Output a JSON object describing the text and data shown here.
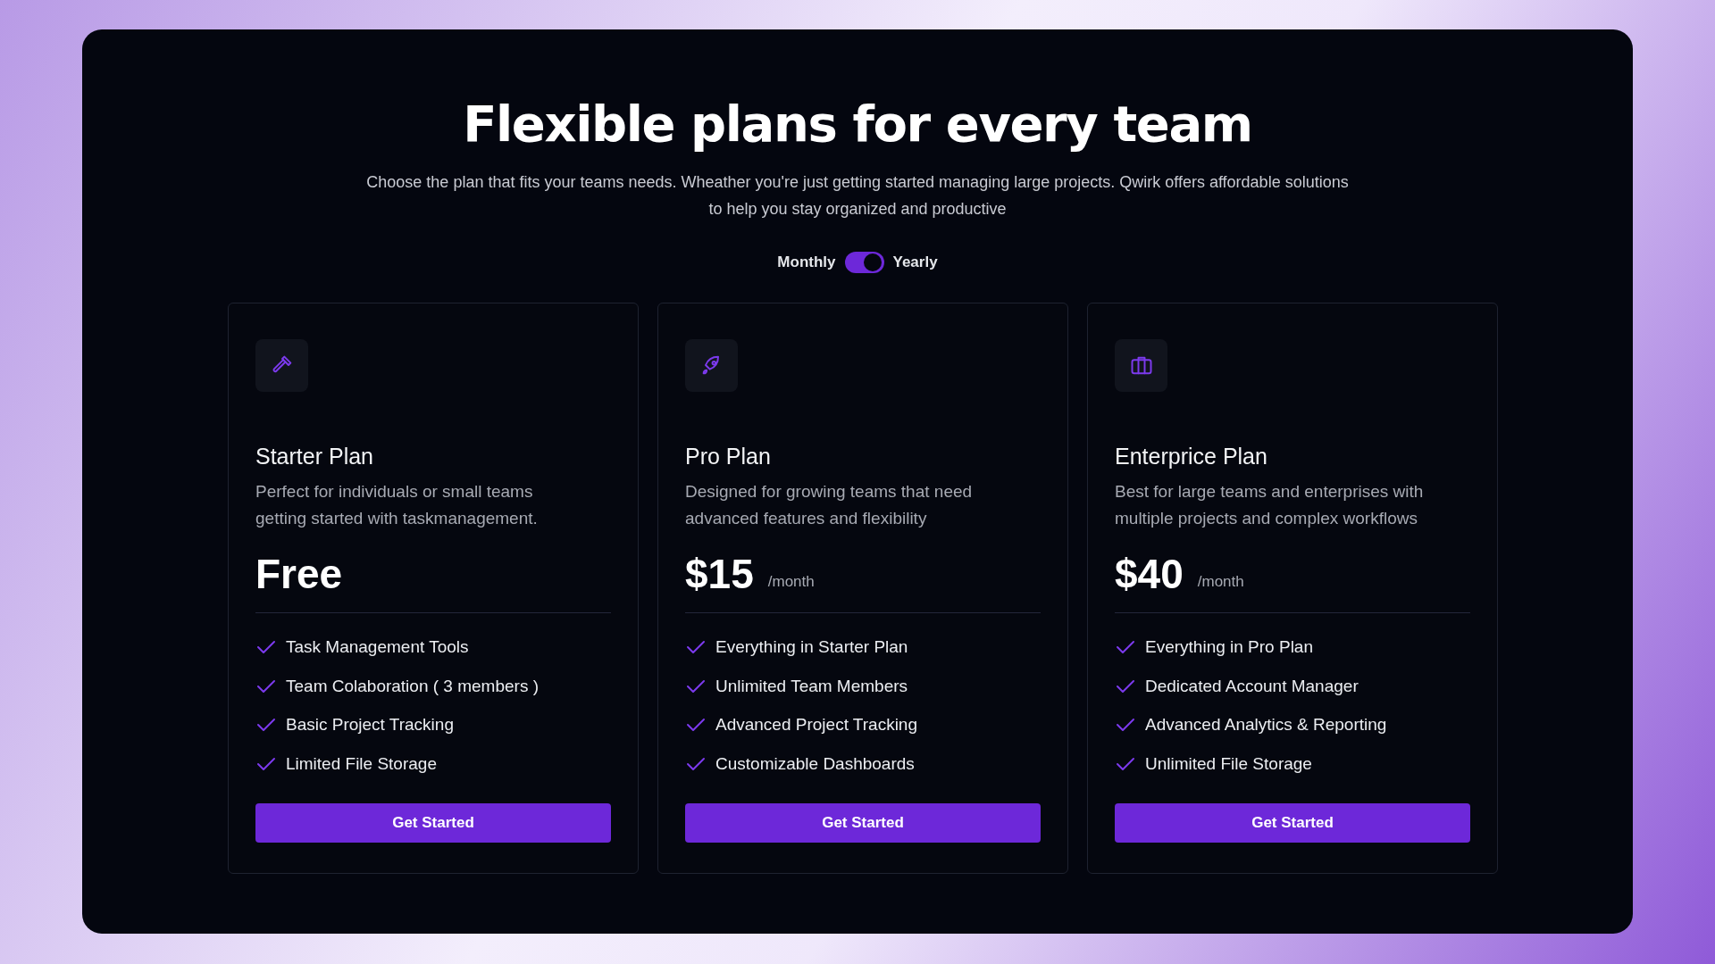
{
  "heading": "Flexible plans for every team",
  "subtitle": "Choose the plan that fits your teams needs. Wheather you're just getting started managing large projects. Qwirk offers affordable solutions to help you stay organized and productive",
  "billing_toggle": {
    "left_label": "Monthly",
    "right_label": "Yearly",
    "on": true
  },
  "plans": [
    {
      "name": "Starter Plan",
      "description": "Perfect for individuals or small teams getting started with taskmanagement.",
      "price": "Free",
      "features": [
        "Task Management Tools",
        "Team Colaboration ( 3 members )",
        "Basic Project Tracking",
        "Limited File Storage"
      ],
      "button": "Get Started"
    },
    {
      "name": "Pro Plan",
      "description": "Designed for growing teams that need advanced features and flexibility",
      "price": "$15",
      "period": "/month",
      "features": [
        "Everything in Starter Plan",
        "Unlimited Team Members",
        "Advanced Project Tracking",
        "Customizable Dashboards"
      ],
      "button": "Get Started"
    },
    {
      "name": "Enterprice Plan",
      "description": "Best for large teams and enterprises with multiple projects and complex workflows",
      "price": "$40",
      "period": "/month",
      "features": [
        "Everything in Pro Plan",
        "Dedicated Account Manager",
        "Advanced Analytics & Reporting",
        "Unlimited File Storage"
      ],
      "button": "Get Started"
    }
  ]
}
